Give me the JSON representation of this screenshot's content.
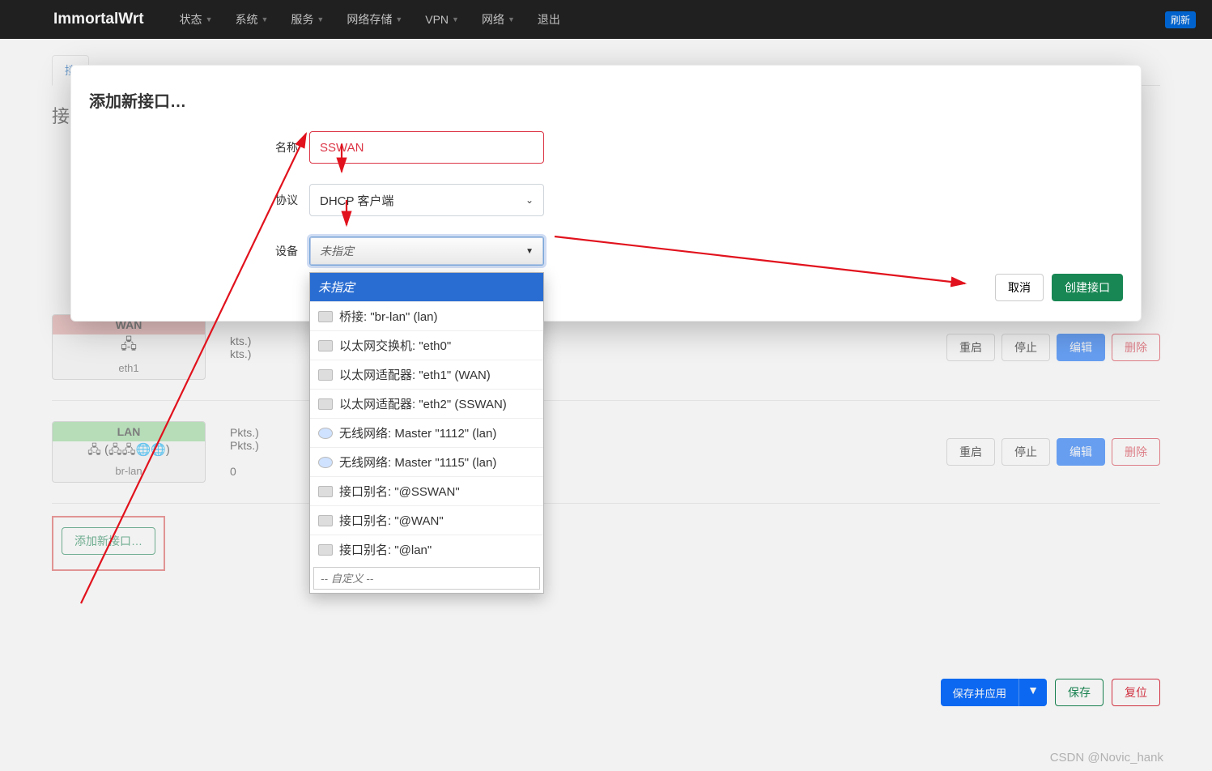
{
  "nav": {
    "brand": "ImmortalWrt",
    "items": [
      {
        "label": "状态",
        "dd": true
      },
      {
        "label": "系统",
        "dd": true
      },
      {
        "label": "服务",
        "dd": true
      },
      {
        "label": "网络存储",
        "dd": true
      },
      {
        "label": "VPN",
        "dd": true
      },
      {
        "label": "网络",
        "dd": true
      },
      {
        "label": "退出",
        "dd": false
      }
    ],
    "refresh": "刷新"
  },
  "tabs": {
    "active": "接"
  },
  "page_title": "接",
  "interfaces": [
    {
      "name": "WAN",
      "dev": "eth1",
      "hdr_class": "wan-hdr",
      "stats_rx": "kts.)",
      "stats_tx": "kts.)"
    },
    {
      "name": "LAN",
      "dev": "br-lan",
      "hdr_class": "lan-hdr",
      "stats_rx": "Pkts.)",
      "stats_tx": "Pkts.)",
      "extra": "0"
    }
  ],
  "iface_buttons": {
    "restart": "重启",
    "stop": "停止",
    "edit": "编辑",
    "delete": "删除"
  },
  "add_iface": "添加新接口…",
  "footer": {
    "save_apply": "保存并应用",
    "save": "保存",
    "reset": "复位"
  },
  "modal": {
    "title": "添加新接口…",
    "labels": {
      "name": "名称",
      "proto": "协议",
      "device": "设备"
    },
    "fields": {
      "name": "SSWAN",
      "proto": "DHCP 客户端",
      "device_placeholder": "未指定"
    },
    "options": [
      {
        "t": "未指定",
        "sel": true,
        "ic": false
      },
      {
        "t": "桥接: \"br-lan\" (lan)",
        "ic": "eth"
      },
      {
        "t": "以太网交换机: \"eth0\"",
        "ic": "eth"
      },
      {
        "t": "以太网适配器: \"eth1\" (WAN)",
        "ic": "eth"
      },
      {
        "t": "以太网适配器: \"eth2\" (SSWAN)",
        "ic": "eth"
      },
      {
        "t": "无线网络: Master \"1112\" (lan)",
        "ic": "wifi"
      },
      {
        "t": "无线网络: Master \"1115\" (lan)",
        "ic": "wifi"
      },
      {
        "t": "接口别名: \"@SSWAN\"",
        "ic": "eth"
      },
      {
        "t": "接口别名: \"@WAN\"",
        "ic": "eth"
      },
      {
        "t": "接口别名: \"@lan\"",
        "ic": "eth"
      }
    ],
    "custom_placeholder": "-- 自定义 --",
    "actions": {
      "cancel": "取消",
      "create": "创建接口"
    }
  },
  "watermark": "CSDN @Novic_hank"
}
